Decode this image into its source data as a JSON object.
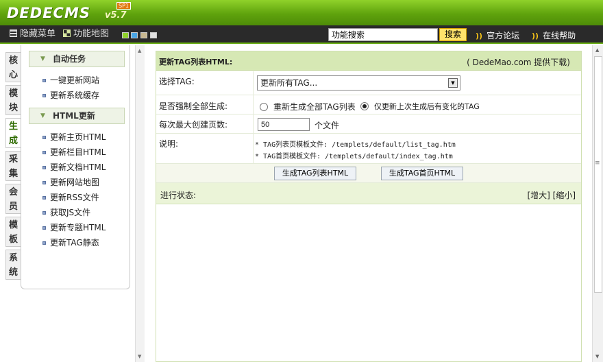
{
  "brand": {
    "name": "DEDECMS",
    "version": "v5.7",
    "badge": "SP1"
  },
  "toolbar": {
    "hide_menu": "隐藏菜单",
    "site_map": "功能地图",
    "skins": [
      "#8fd12a",
      "#49a6e6",
      "#c8b890",
      "#e0e0e0"
    ],
    "search_value": "功能搜索",
    "search_button": "搜索",
    "forum": "官方论坛",
    "help": "在线帮助"
  },
  "vtabs": [
    "核心",
    "模块",
    "生成",
    "采集",
    "会员",
    "模板",
    "系统"
  ],
  "menu": {
    "group1": {
      "title": "自动任务",
      "items": [
        "一键更新网站",
        "更新系统缓存"
      ]
    },
    "group2": {
      "title": "HTML更新",
      "items": [
        "更新主页HTML",
        "更新栏目HTML",
        "更新文档HTML",
        "更新网站地图",
        "更新RSS文件",
        "获取JS文件",
        "更新专题HTML",
        "更新TAG静态"
      ]
    }
  },
  "form": {
    "title": "更新TAG列表HTML:",
    "credit": "( DedeMao.com 提供下载)",
    "select_label": "选择TAG:",
    "select_value": "更新所有TAG...",
    "force_label": "是否强制全部生成:",
    "opt_all": "重新生成全部TAG列表",
    "opt_changed": "仅更新上次生成后有变化的TAG",
    "pages_label": "每次最大创建页数:",
    "pages_value": "50",
    "pages_unit": "个文件",
    "note_label": "说明:",
    "note1": "* TAG列表页模板文件: /templets/default/list_tag.htm",
    "note2": "* TAG首页模板文件: /templets/default/index_tag.htm",
    "btn_list": "生成TAG列表HTML",
    "btn_index": "生成TAG首页HTML",
    "status_label": "进行状态:",
    "status_ctrl": "[增大] [缩小]"
  }
}
